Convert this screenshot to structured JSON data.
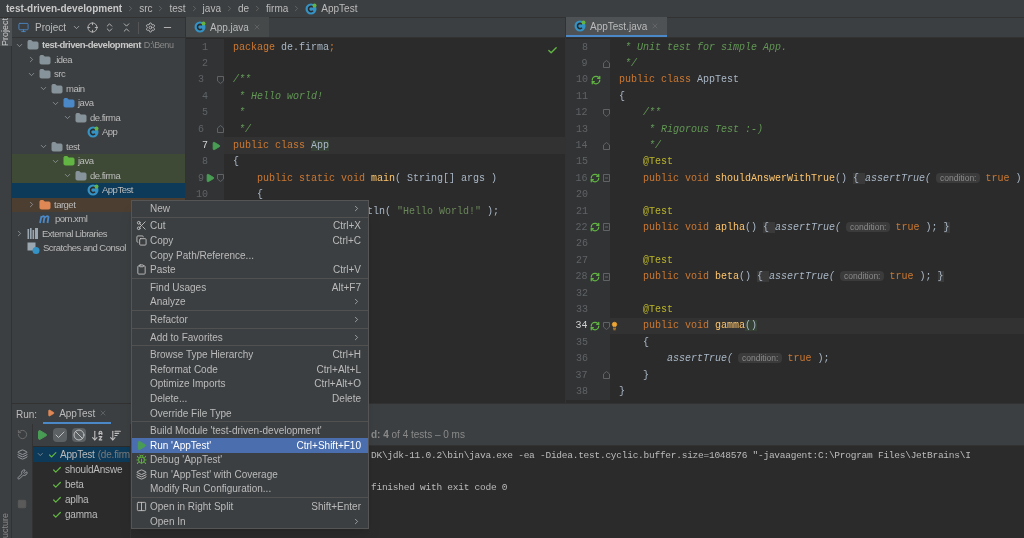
{
  "breadcrumbs": [
    "test-driven-development",
    "src",
    "test",
    "java",
    "de",
    "firma",
    "AppTest"
  ],
  "tool_strip": {
    "top": "Project",
    "bottom": "ucture"
  },
  "project_panel": {
    "title": "Project",
    "tree": [
      {
        "label": "test-driven-development",
        "path": "D:\\Benu",
        "kind": "module",
        "expanded": true,
        "selected": false,
        "children": [
          {
            "label": ".idea",
            "kind": "folder",
            "expanded": false,
            "selected": false
          },
          {
            "label": "src",
            "kind": "folder",
            "expanded": true,
            "selected": false,
            "children": [
              {
                "label": "main",
                "kind": "folder",
                "expanded": true,
                "selected": false,
                "children": [
                  {
                    "label": "java",
                    "kind": "source_folder",
                    "expanded": true,
                    "selected": false,
                    "children": [
                      {
                        "label": "de.firma",
                        "kind": "package",
                        "expanded": true,
                        "selected": false,
                        "children": [
                          {
                            "label": "App",
                            "kind": "class",
                            "selected": false
                          }
                        ]
                      }
                    ]
                  }
                ]
              },
              {
                "label": "test",
                "kind": "folder",
                "expanded": true,
                "selected": false,
                "children": [
                  {
                    "label": "java",
                    "kind": "test_folder",
                    "expanded": true,
                    "selected": false,
                    "children": [
                      {
                        "label": "de.firma",
                        "kind": "test_package",
                        "expanded": true,
                        "selected": false,
                        "children": [
                          {
                            "label": "AppTest",
                            "kind": "class",
                            "selected": true
                          }
                        ]
                      }
                    ]
                  }
                ]
              }
            ]
          },
          {
            "label": "target",
            "kind": "excluded_folder",
            "expanded": false,
            "selected": false
          },
          {
            "label": "pom.xml",
            "kind": "maven",
            "selected": false
          }
        ]
      },
      {
        "label": "External Libraries",
        "kind": "libraries",
        "expanded": false,
        "selected": false
      },
      {
        "label": "Scratches and Consol",
        "kind": "scratches",
        "selected": false
      }
    ]
  },
  "editors": [
    {
      "tab": {
        "label": "App.java",
        "selected": false
      },
      "inspection_ok": true,
      "lines": [
        {
          "number": "1",
          "current": false,
          "covered": false,
          "tokens": [
            {
              "kind": "keyword",
              "text": "package"
            },
            {
              "kind": "plain",
              "text": " de.firma"
            },
            {
              "kind": "keyword",
              "text": ";"
            }
          ]
        },
        {
          "number": "2",
          "current": false,
          "covered": false
        },
        {
          "number": "3",
          "current": false,
          "covered": false,
          "fold": {
            "kind": "start"
          },
          "tokens": [
            {
              "kind": "comment",
              "text": "/**"
            }
          ]
        },
        {
          "number": "4",
          "current": false,
          "covered": false,
          "tokens": [
            {
              "kind": "comment",
              "text": " * Hello world!"
            }
          ]
        },
        {
          "number": "5",
          "current": false,
          "covered": false,
          "tokens": [
            {
              "kind": "comment",
              "text": " *"
            }
          ]
        },
        {
          "number": "6",
          "current": false,
          "covered": false,
          "fold": {
            "kind": "end"
          },
          "tokens": [
            {
              "kind": "comment",
              "text": " */"
            }
          ]
        },
        {
          "number": "7",
          "current": true,
          "covered": false,
          "marker": {
            "kind": "run"
          },
          "tokens": [
            {
              "kind": "keyword",
              "text": "public class "
            },
            {
              "kind": "usage",
              "text": "App"
            }
          ]
        },
        {
          "number": "8",
          "current": false,
          "covered": false,
          "tokens": [
            {
              "kind": "plain",
              "text": "{"
            }
          ]
        },
        {
          "number": "9",
          "current": false,
          "covered": false,
          "marker": {
            "kind": "run"
          },
          "fold": {
            "kind": "start"
          },
          "tokens": [
            {
              "kind": "keyword",
              "text": "    public static void "
            },
            {
              "kind": "method",
              "text": "main"
            },
            {
              "kind": "plain",
              "text": "( String[] args )"
            }
          ]
        },
        {
          "number": "10",
          "current": false,
          "covered": false,
          "tokens": [
            {
              "kind": "plain",
              "text": "    {"
            }
          ]
        },
        {
          "current": false,
          "covered": true,
          "tokens": [
            {
              "kind": "plain",
              "text": "tln( "
            },
            {
              "kind": "string",
              "text": "\"Hello World!\""
            },
            {
              "kind": "plain",
              "text": " );"
            }
          ]
        }
      ]
    },
    {
      "tab": {
        "label": "AppTest.java",
        "selected": true
      },
      "inspection_ok": false,
      "lines": [
        {
          "number": "8",
          "current": false,
          "covered": false,
          "tokens": [
            {
              "kind": "comment",
              "text": " * Unit test for simple App."
            }
          ]
        },
        {
          "number": "9",
          "current": false,
          "covered": false,
          "fold": {
            "kind": "end"
          },
          "tokens": [
            {
              "kind": "comment",
              "text": " */"
            }
          ]
        },
        {
          "number": "10",
          "current": false,
          "covered": false,
          "marker": {
            "kind": "rerun"
          },
          "tokens": [
            {
              "kind": "keyword",
              "text": "public class "
            },
            {
              "kind": "plain",
              "text": "AppTest"
            }
          ]
        },
        {
          "number": "11",
          "current": false,
          "covered": false,
          "tokens": [
            {
              "kind": "plain",
              "text": "{"
            }
          ]
        },
        {
          "number": "12",
          "current": false,
          "covered": false,
          "fold": {
            "kind": "start"
          },
          "tokens": [
            {
              "kind": "comment",
              "text": "    /**"
            }
          ]
        },
        {
          "number": "13",
          "current": false,
          "covered": false,
          "tokens": [
            {
              "kind": "comment",
              "text": "     * Rigorous Test :-)"
            }
          ]
        },
        {
          "number": "14",
          "current": false,
          "covered": false,
          "fold": {
            "kind": "end"
          },
          "tokens": [
            {
              "kind": "comment",
              "text": "     */"
            }
          ]
        },
        {
          "number": "15",
          "current": false,
          "covered": false,
          "tokens": [
            {
              "kind": "annotation",
              "text": "    @Test"
            }
          ]
        },
        {
          "number": "16",
          "current": false,
          "covered": false,
          "marker": {
            "kind": "rerun"
          },
          "fold": {
            "kind": "collapsed"
          },
          "tokens": [
            {
              "kind": "keyword",
              "text": "    public void "
            },
            {
              "kind": "method",
              "text": "shouldAnswerWithTrue"
            },
            {
              "kind": "plain",
              "text": "() "
            },
            {
              "kind": "folded",
              "text": "{ "
            },
            {
              "kind": "call",
              "text": "assertTrue("
            },
            {
              "kind": "hint",
              "text": "condition:"
            },
            {
              "kind": "keyword",
              "text": "true"
            },
            {
              "kind": "plain",
              "text": " )"
            }
          ]
        },
        {
          "number": "20",
          "current": false,
          "covered": false
        },
        {
          "number": "21",
          "current": false,
          "covered": false,
          "tokens": [
            {
              "kind": "annotation",
              "text": "    @Test"
            }
          ]
        },
        {
          "number": "22",
          "current": false,
          "covered": false,
          "marker": {
            "kind": "rerun"
          },
          "fold": {
            "kind": "collapsed"
          },
          "tokens": [
            {
              "kind": "keyword",
              "text": "    public void "
            },
            {
              "kind": "method",
              "text": "aplha"
            },
            {
              "kind": "plain",
              "text": "() "
            },
            {
              "kind": "folded",
              "text": "{ "
            },
            {
              "kind": "call",
              "text": "assertTrue("
            },
            {
              "kind": "hint",
              "text": "condition:"
            },
            {
              "kind": "keyword",
              "text": "true"
            },
            {
              "kind": "plain",
              "text": " ); "
            },
            {
              "kind": "folded",
              "text": "}"
            }
          ]
        },
        {
          "number": "26",
          "current": false,
          "covered": false
        },
        {
          "number": "27",
          "current": false,
          "covered": false,
          "tokens": [
            {
              "kind": "annotation",
              "text": "    @Test"
            }
          ]
        },
        {
          "number": "28",
          "current": false,
          "covered": false,
          "marker": {
            "kind": "rerun"
          },
          "fold": {
            "kind": "collapsed"
          },
          "tokens": [
            {
              "kind": "keyword",
              "text": "    public void "
            },
            {
              "kind": "method",
              "text": "beta"
            },
            {
              "kind": "plain",
              "text": "() "
            },
            {
              "kind": "folded",
              "text": "{ "
            },
            {
              "kind": "call",
              "text": "assertTrue("
            },
            {
              "kind": "hint",
              "text": "condition:"
            },
            {
              "kind": "keyword",
              "text": "true"
            },
            {
              "kind": "plain",
              "text": " ); "
            },
            {
              "kind": "folded",
              "text": "}"
            }
          ]
        },
        {
          "number": "32",
          "current": false,
          "covered": false
        },
        {
          "number": "33",
          "current": false,
          "covered": false,
          "tokens": [
            {
              "kind": "annotation",
              "text": "    @Test"
            }
          ]
        },
        {
          "number": "34",
          "current": true,
          "covered": false,
          "marker": {
            "kind": "rerun"
          },
          "fold": {
            "kind": "start"
          },
          "bulb": true,
          "tokens": [
            {
              "kind": "keyword",
              "text": "    public void "
            },
            {
              "kind": "method",
              "text": "gamma"
            },
            {
              "kind": "usage",
              "text": "()"
            }
          ]
        },
        {
          "number": "35",
          "current": false,
          "covered": false,
          "tokens": [
            {
              "kind": "plain",
              "text": "    {"
            }
          ]
        },
        {
          "number": "36",
          "current": false,
          "covered": false,
          "tokens": [
            {
              "kind": "call",
              "text": "        assertTrue("
            },
            {
              "kind": "hint",
              "text": "condition:"
            },
            {
              "kind": "keyword",
              "text": "true"
            },
            {
              "kind": "plain",
              "text": " );"
            }
          ]
        },
        {
          "number": "37",
          "current": false,
          "covered": false,
          "fold": {
            "kind": "end"
          },
          "tokens": [
            {
              "kind": "plain",
              "text": "    }"
            }
          ]
        },
        {
          "number": "38",
          "current": false,
          "covered": false,
          "tokens": [
            {
              "kind": "plain",
              "text": "}"
            }
          ]
        }
      ]
    }
  ],
  "run_panel": {
    "label": "Run:",
    "tab": "AppTest",
    "toolbar": [
      {
        "kind": "rerun",
        "on": false
      },
      {
        "kind": "show_passed",
        "on": true
      },
      {
        "kind": "show_ignored",
        "on": true
      },
      {
        "kind": "sort_alpha",
        "on": false
      },
      {
        "kind": "sort_duration",
        "on": false
      }
    ],
    "tests": [
      {
        "label": "AppTest",
        "detail": "(de.firm",
        "passed": true,
        "selected": true,
        "children": [
          {
            "label": "shouldAnswe",
            "passed": true,
            "selected": false
          },
          {
            "label": "beta",
            "passed": true,
            "selected": false
          },
          {
            "label": "aplha",
            "passed": true,
            "selected": false
          },
          {
            "label": "gamma",
            "passed": true,
            "selected": false
          }
        ]
      }
    ],
    "status": "**d: 4** of 4 tests – 0 ms",
    "console": [
      "DK\\jdk-11.0.2\\bin\\java.exe -ea -Didea.test.cyclic.buffer.size=1048576 \"-javaagent:C:\\Program Files\\JetBrains\\I",
      "finished with exit code 0"
    ]
  },
  "context_menu": [
    {
      "kind": "submenu",
      "label": "New",
      "selected": false
    },
    {
      "kind": "separator"
    },
    {
      "kind": "cut",
      "label": "Cut",
      "shortcut": "Ctrl+X",
      "selected": false
    },
    {
      "kind": "copy",
      "label": "Copy",
      "shortcut": "Ctrl+C",
      "selected": false
    },
    {
      "kind": "item",
      "label": "Copy Path/Reference...",
      "selected": false
    },
    {
      "kind": "paste",
      "label": "Paste",
      "shortcut": "Ctrl+V",
      "selected": false
    },
    {
      "kind": "separator"
    },
    {
      "kind": "item",
      "label": "Find Usages",
      "shortcut": "Alt+F7",
      "selected": false
    },
    {
      "kind": "submenu",
      "label": "Analyze",
      "selected": false
    },
    {
      "kind": "separator"
    },
    {
      "kind": "submenu",
      "label": "Refactor",
      "selected": false
    },
    {
      "kind": "separator"
    },
    {
      "kind": "submenu",
      "label": "Add to Favorites",
      "selected": false
    },
    {
      "kind": "separator"
    },
    {
      "kind": "item",
      "label": "Browse Type Hierarchy",
      "shortcut": "Ctrl+H",
      "selected": false
    },
    {
      "kind": "item",
      "label": "Reformat Code",
      "shortcut": "Ctrl+Alt+L",
      "selected": false
    },
    {
      "kind": "item",
      "label": "Optimize Imports",
      "shortcut": "Ctrl+Alt+O",
      "selected": false
    },
    {
      "kind": "item",
      "label": "Delete...",
      "shortcut": "Delete",
      "selected": false
    },
    {
      "kind": "item",
      "label": "Override File Type",
      "selected": false
    },
    {
      "kind": "separator"
    },
    {
      "kind": "item",
      "label": "Build Module 'test-driven-development'",
      "selected": false
    },
    {
      "kind": "run",
      "label": "Run 'AppTest'",
      "shortcut": "Ctrl+Shift+F10",
      "selected": true
    },
    {
      "kind": "debug",
      "label": "Debug 'AppTest'",
      "selected": false
    },
    {
      "kind": "coverage",
      "label": "Run 'AppTest' with Coverage",
      "selected": false
    },
    {
      "kind": "item",
      "label": "Modify Run Configuration...",
      "selected": false
    },
    {
      "kind": "separator"
    },
    {
      "kind": "split",
      "label": "Open in Right Split",
      "shortcut": "Shift+Enter",
      "selected": false
    },
    {
      "kind": "submenu",
      "label": "Open In",
      "selected": false
    }
  ]
}
